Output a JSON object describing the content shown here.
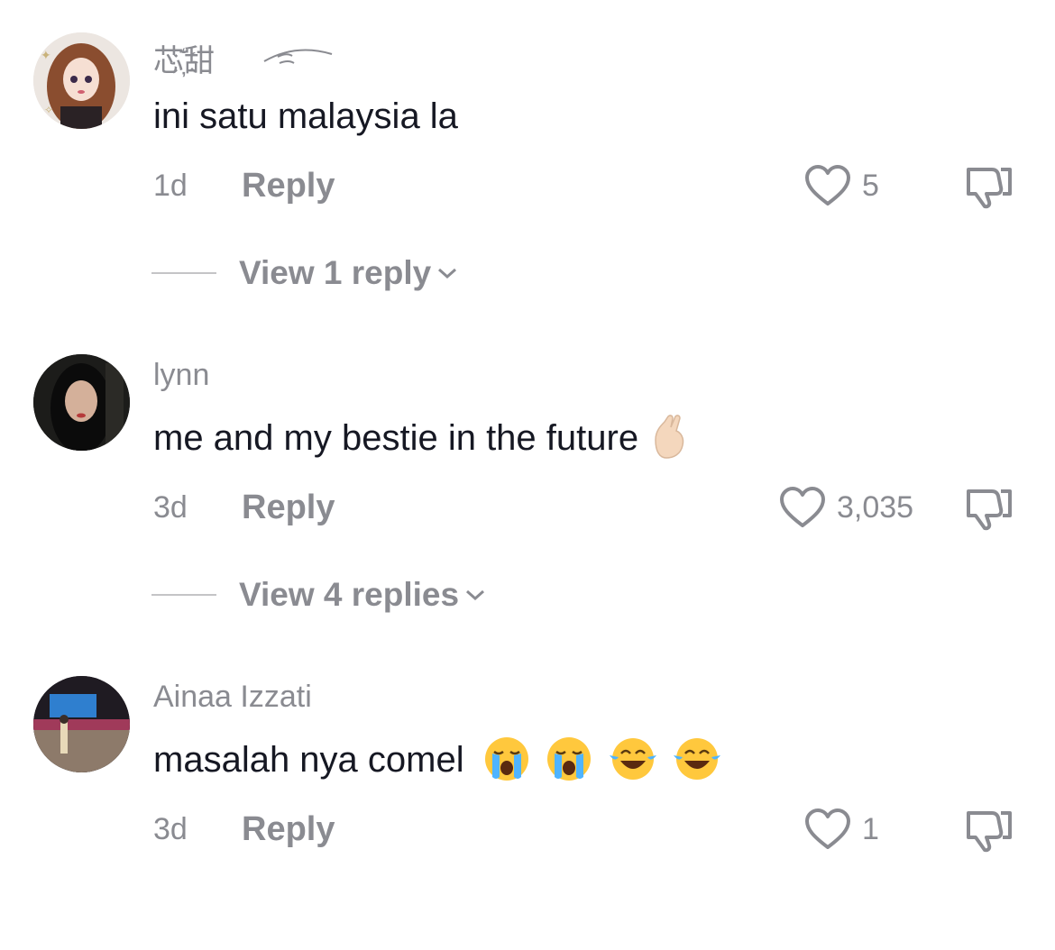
{
  "comments": [
    {
      "username": "芯҉̆̈甜",
      "text": "ini satu malaysia la",
      "time": "1d",
      "reply_label": "Reply",
      "likes": "5",
      "view_replies": "View 1 reply"
    },
    {
      "username": "lynn",
      "text": "me and my bestie in the future",
      "time": "3d",
      "reply_label": "Reply",
      "likes": "3,035",
      "view_replies": "View 4 replies"
    },
    {
      "username": "Ainaa Izzati",
      "text": "masalah nya comel",
      "time": "3d",
      "reply_label": "Reply",
      "likes": "1"
    }
  ],
  "icons": {
    "like": "heart-outline-icon",
    "dislike": "thumbs-down-icon",
    "expand": "chevron-down-icon"
  },
  "colors": {
    "primary_text": "#161823",
    "secondary_text": "#8a8b91"
  }
}
